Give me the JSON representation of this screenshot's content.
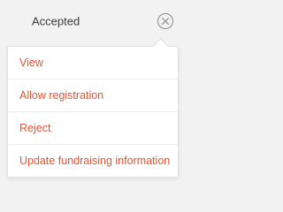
{
  "status": {
    "label": "Accepted"
  },
  "close_button": {
    "icon": "close-icon"
  },
  "menu": {
    "items": [
      {
        "label": "View"
      },
      {
        "label": "Allow registration"
      },
      {
        "label": "Reject"
      },
      {
        "label": "Update fundraising information"
      }
    ]
  },
  "colors": {
    "accent": "#e8512c",
    "text": "#3a3a3a",
    "background": "#f2f2f2"
  }
}
